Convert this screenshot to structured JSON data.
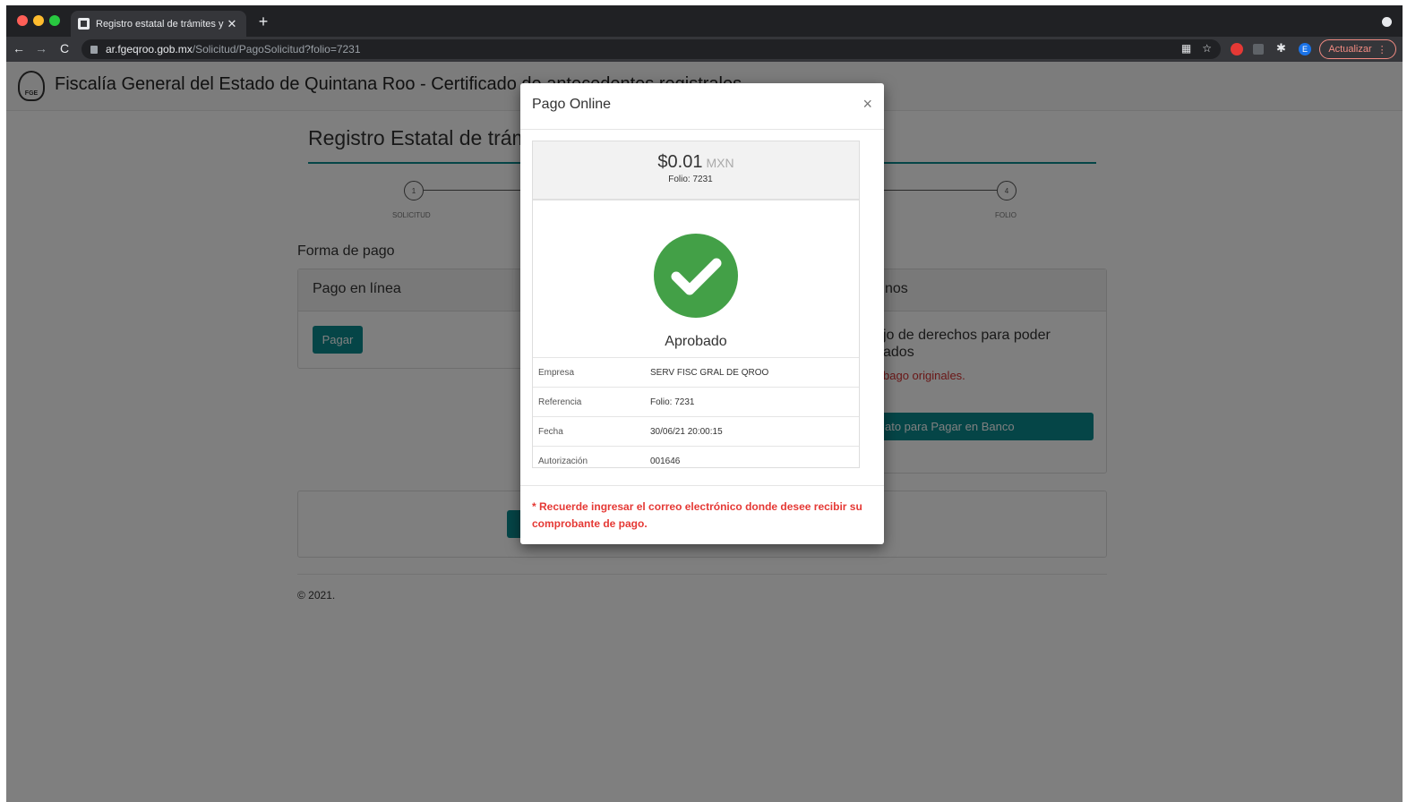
{
  "browser": {
    "tab_title": "Registro estatal de trámites y s",
    "url_host": "ar.fgeqroo.gob.mx",
    "url_path": "/Solicitud/PagoSolicitud?folio=7231",
    "update_label": "Actualizar",
    "avatar_letter": "E"
  },
  "site": {
    "logo_text": "FGE",
    "title": "Fiscalía General del Estado de Quintana Roo - Certificado de antecedentes registrales"
  },
  "page": {
    "main_title": "Registro Estatal de trámites y servicios",
    "steps": [
      {
        "number": "1",
        "label": "SOLICITUD"
      },
      {
        "number": "4",
        "label": "FOLIO"
      }
    ],
    "section_title": "Forma de pago",
    "online_panel": {
      "title": "Pago en línea",
      "button": "Pagar"
    },
    "bank_panel": {
      "title": "nos",
      "text_line1": "jo de derechos para poder",
      "text_line2": "ados",
      "red_text": "bago originales.",
      "button": "ato para Pagar en Banco"
    },
    "footer": "© 2021."
  },
  "modal": {
    "title": "Pago Online",
    "close": "×",
    "amount": "$0.01",
    "currency": "MXN",
    "folio": "Folio: 7231",
    "status": "Aprobado",
    "rows": [
      {
        "key": "Empresa",
        "value": "SERV FISC GRAL DE QROO"
      },
      {
        "key": "Referencia",
        "value": "Folio: 7231"
      },
      {
        "key": "Fecha",
        "value": "30/06/21 20:00:15"
      },
      {
        "key": "Autorización",
        "value": "001646"
      }
    ],
    "notice": "* Recuerde ingresar el correo electrónico donde desee recibir su comprobante de pago."
  },
  "colors": {
    "accent": "#0a8a8e",
    "success": "#43a047",
    "alert": "#e53935"
  }
}
